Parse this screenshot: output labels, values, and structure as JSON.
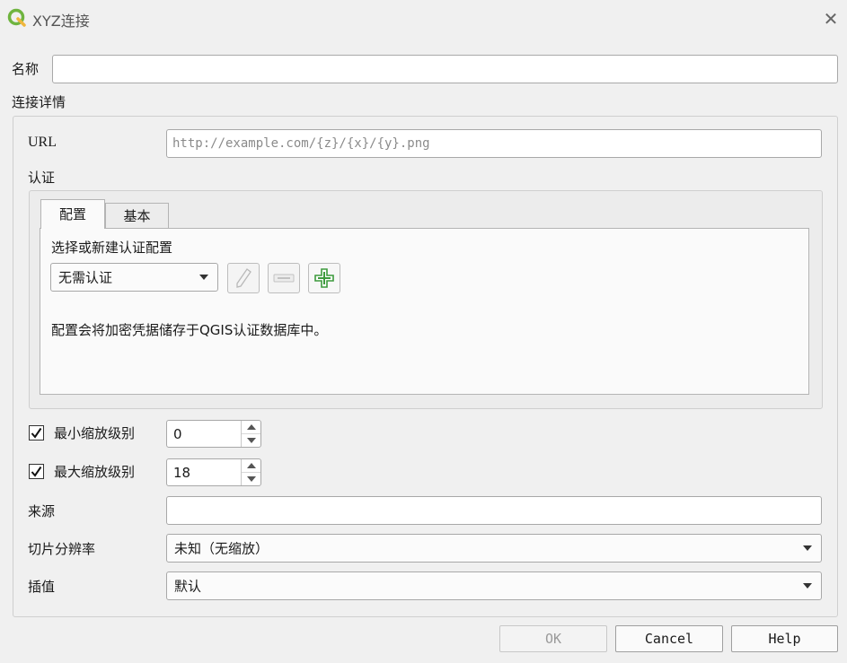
{
  "window": {
    "title": "XYZ连接",
    "close_icon": "close-icon"
  },
  "name": {
    "label": "名称",
    "value": ""
  },
  "details": {
    "label": "连接详情"
  },
  "url": {
    "label": "URL",
    "placeholder": "http://example.com/{z}/{x}/{y}.png",
    "value": ""
  },
  "auth": {
    "label": "认证",
    "tabs": [
      "配置",
      "基本"
    ],
    "active_tab": "配置",
    "select_label": "选择或新建认证配置",
    "combo_value": "无需认证",
    "note": "配置会将加密凭据储存于QGIS认证数据库中。",
    "icons": [
      "edit-pencil-icon",
      "remove-icon",
      "add-icon"
    ]
  },
  "min_zoom": {
    "label": "最小缩放级别",
    "checked": true,
    "value": "0"
  },
  "max_zoom": {
    "label": "最大缩放级别",
    "checked": true,
    "value": "18"
  },
  "source": {
    "label": "来源",
    "value": ""
  },
  "tile_resolution": {
    "label": "切片分辨率",
    "value": "未知（无缩放）"
  },
  "interpolation": {
    "label": "插值",
    "value": "默认"
  },
  "buttons": {
    "ok": "OK",
    "cancel": "Cancel",
    "help": "Help"
  },
  "colors": {
    "accent_green": "#3d9a3d",
    "qgis_logo": "#6fb43f"
  }
}
